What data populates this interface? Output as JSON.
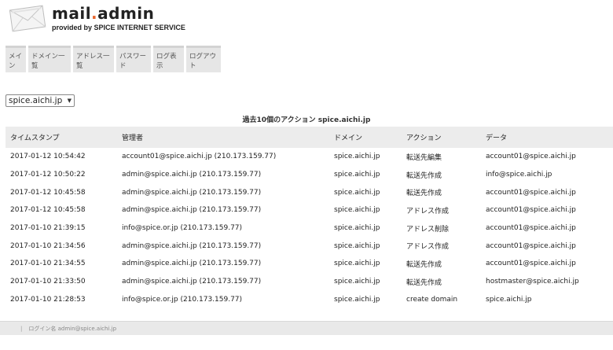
{
  "brand": {
    "name_part1": "mail",
    "name_dot": ".",
    "name_part2": "admin",
    "tagline": "provided by SPICE INTERNET SERVICE"
  },
  "nav": [
    "メイン",
    "ドメイン一覧",
    "アドレス一覧",
    "パスワード",
    "ログ表示",
    "ログアウト"
  ],
  "domain_select": {
    "value": "spice.aichi.jp"
  },
  "table": {
    "title": "過去10個のアクション spice.aichi.jp",
    "headers": [
      "タイムスタンプ",
      "管理者",
      "ドメイン",
      "アクション",
      "データ"
    ],
    "rows": [
      [
        "2017-01-12 10:54:42",
        "account01@spice.aichi.jp (210.173.159.77)",
        "spice.aichi.jp",
        "転送先編集",
        "account01@spice.aichi.jp"
      ],
      [
        "2017-01-12 10:50:22",
        "admin@spice.aichi.jp (210.173.159.77)",
        "spice.aichi.jp",
        "転送先作成",
        "info@spice.aichi.jp"
      ],
      [
        "2017-01-12 10:45:58",
        "admin@spice.aichi.jp (210.173.159.77)",
        "spice.aichi.jp",
        "転送先作成",
        "account01@spice.aichi.jp"
      ],
      [
        "2017-01-12 10:45:58",
        "admin@spice.aichi.jp (210.173.159.77)",
        "spice.aichi.jp",
        "アドレス作成",
        "account01@spice.aichi.jp"
      ],
      [
        "2017-01-10 21:39:15",
        "info@spice.or.jp (210.173.159.77)",
        "spice.aichi.jp",
        "アドレス削除",
        "account01@spice.aichi.jp"
      ],
      [
        "2017-01-10 21:34:56",
        "admin@spice.aichi.jp (210.173.159.77)",
        "spice.aichi.jp",
        "アドレス作成",
        "account01@spice.aichi.jp"
      ],
      [
        "2017-01-10 21:34:55",
        "admin@spice.aichi.jp (210.173.159.77)",
        "spice.aichi.jp",
        "転送先作成",
        "account01@spice.aichi.jp"
      ],
      [
        "2017-01-10 21:33:50",
        "admin@spice.aichi.jp (210.173.159.77)",
        "spice.aichi.jp",
        "転送先作成",
        "hostmaster@spice.aichi.jp"
      ],
      [
        "2017-01-10 21:28:53",
        "info@spice.or.jp (210.173.159.77)",
        "spice.aichi.jp",
        "create domain",
        "spice.aichi.jp"
      ]
    ]
  },
  "footer": {
    "separator": "|",
    "login_text": "ログイン名 admin@spice.aichi.jp"
  }
}
